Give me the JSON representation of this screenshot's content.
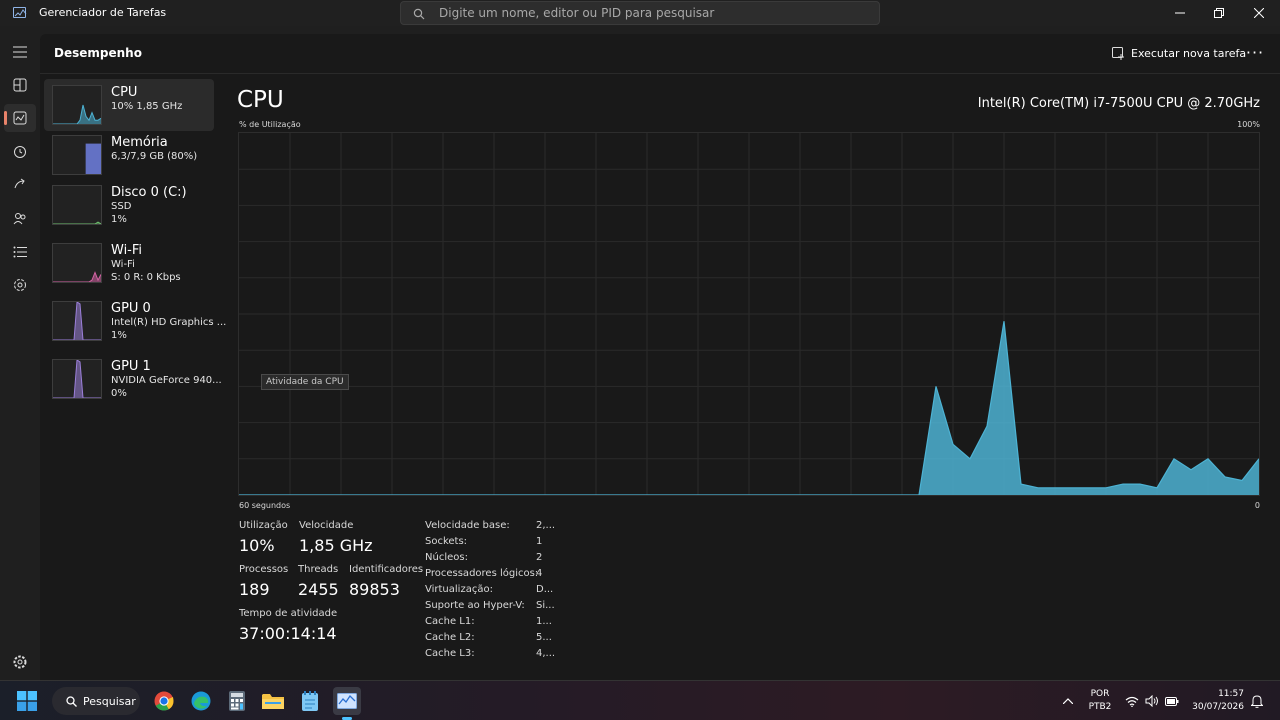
{
  "window": {
    "title": "Gerenciador de Tarefas",
    "search_placeholder": "Digite um nome, editor ou PID para pesquisar"
  },
  "header": {
    "page_title": "Desempenho",
    "run_task_label": "Executar nova tarefa",
    "more_label": "···"
  },
  "devices": [
    {
      "name": "CPU",
      "line1": "10%  1,85 GHz",
      "line2": "",
      "color": "#4db3d4"
    },
    {
      "name": "Memória",
      "line1": "6,3/7,9 GB (80%)",
      "line2": "",
      "color": "#6f7fe0"
    },
    {
      "name": "Disco 0 (C:)",
      "line1": "SSD",
      "line2": "1%",
      "color": "#6fbf6f"
    },
    {
      "name": "Wi-Fi",
      "line1": "Wi-Fi",
      "line2": "S: 0 R: 0 Kbps",
      "color": "#d463a4"
    },
    {
      "name": "GPU 0",
      "line1": "Intel(R) HD Graphics ...",
      "line2": "1%",
      "color": "#9b7fd9"
    },
    {
      "name": "GPU 1",
      "line1": "NVIDIA GeForce 940...",
      "line2": "0%",
      "color": "#9b7fd9"
    }
  ],
  "cpu": {
    "title": "CPU",
    "model": "Intel(R) Core(TM) i7-7500U CPU @ 2.70GHz",
    "y_axis_label": "% de Utilização",
    "y_max_label": "100%",
    "x_left_label": "60 segundos",
    "x_right_label": "0",
    "tooltip": "Atividade da CPU",
    "accent": "#4db3d4"
  },
  "chart_data": {
    "type": "area",
    "ylim": [
      0,
      100
    ],
    "xlim": [
      60,
      0
    ],
    "x_unit": "segundos",
    "values": [
      0,
      0,
      0,
      0,
      0,
      0,
      0,
      0,
      0,
      0,
      0,
      0,
      0,
      0,
      0,
      0,
      0,
      0,
      0,
      0,
      0,
      0,
      0,
      0,
      0,
      0,
      0,
      0,
      0,
      0,
      0,
      0,
      0,
      0,
      0,
      0,
      0,
      0,
      0,
      0,
      0,
      30,
      14,
      10,
      19,
      48,
      3,
      2,
      2,
      2,
      2,
      2,
      3,
      3,
      2,
      10,
      7,
      10,
      5,
      4,
      10
    ]
  },
  "stats": {
    "utilization_label": "Utilização",
    "utilization_value": "10%",
    "speed_label": "Velocidade",
    "speed_value": "1,85 GHz",
    "processes_label": "Processos",
    "processes_value": "189",
    "threads_label": "Threads",
    "threads_value": "2455",
    "handles_label": "Identificadores",
    "handles_value": "89853",
    "uptime_label": "Tempo de atividade",
    "uptime_value": "37:00:14:14"
  },
  "specs": [
    {
      "label": "Velocidade base:",
      "value": "2,..."
    },
    {
      "label": "Sockets:",
      "value": "1"
    },
    {
      "label": "Núcleos:",
      "value": "2"
    },
    {
      "label": "Processadores lógicos:",
      "value": "4"
    },
    {
      "label": "Virtualização:",
      "value": "D..."
    },
    {
      "label": "Suporte ao Hyper-V:",
      "value": "Si..."
    },
    {
      "label": "Cache L1:",
      "value": "1..."
    },
    {
      "label": "Cache L2:",
      "value": "5..."
    },
    {
      "label": "Cache L3:",
      "value": "4,..."
    }
  ],
  "taskbar": {
    "search_label": "Pesquisar",
    "lang_line1": "POR",
    "lang_line2": "PTB2",
    "time": "11:57",
    "date": "30/07/2026"
  }
}
